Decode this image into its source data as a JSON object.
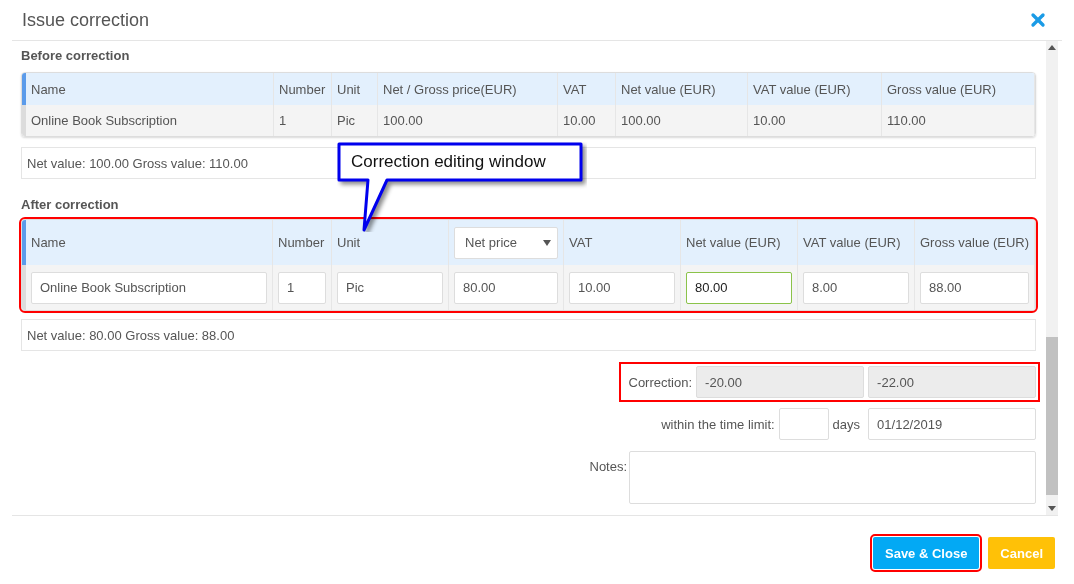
{
  "dialog": {
    "title": "Issue correction"
  },
  "before": {
    "heading": "Before correction",
    "columns": [
      "Name",
      "Number",
      "Unit",
      "Net / Gross price(EUR)",
      "VAT",
      "Net value (EUR)",
      "VAT value (EUR)",
      "Gross value (EUR)"
    ],
    "rows": [
      [
        "Online Book Subscription",
        "1",
        "Pic",
        "100.00",
        "10.00",
        "100.00",
        "10.00",
        "110.00"
      ]
    ],
    "summary": "Net value: 100.00 Gross value: 110.00"
  },
  "callout": {
    "text": "Correction editing window"
  },
  "after": {
    "heading": "After correction",
    "highlighted": true,
    "columns": [
      {
        "label": "Name",
        "kind": "text"
      },
      {
        "label": "Number",
        "kind": "text"
      },
      {
        "label": "Unit",
        "kind": "text"
      },
      {
        "label": "Net price",
        "kind": "select"
      },
      {
        "label": "VAT",
        "kind": "text"
      },
      {
        "label": "Net value (EUR)",
        "kind": "text"
      },
      {
        "label": "VAT value (EUR)",
        "kind": "text"
      },
      {
        "label": "Gross value (EUR)",
        "kind": "text"
      }
    ],
    "rows": [
      {
        "cells": [
          {
            "value": "Online Book Subscription",
            "focused": false
          },
          {
            "value": "1",
            "focused": false
          },
          {
            "value": "Pic",
            "focused": false
          },
          {
            "value": "80.00",
            "focused": false
          },
          {
            "value": "10.00",
            "focused": false
          },
          {
            "value": "80.00",
            "focused": true
          },
          {
            "value": "8.00",
            "focused": false
          },
          {
            "value": "88.00",
            "focused": false
          }
        ]
      }
    ],
    "summary": "Net value: 80.00 Gross value: 88.00"
  },
  "correction": {
    "label": "Correction:",
    "values": [
      "-20.00",
      "-22.00"
    ],
    "highlighted": true
  },
  "time_limit": {
    "label": "within the time limit:",
    "unit": "days",
    "date": "01/12/2019"
  },
  "notes": {
    "label": "Notes:"
  },
  "buttons": [
    {
      "label": "Save & Close",
      "kind": "primary",
      "highlighted": true
    },
    {
      "label": "Cancel",
      "kind": "warning",
      "highlighted": false
    }
  ]
}
